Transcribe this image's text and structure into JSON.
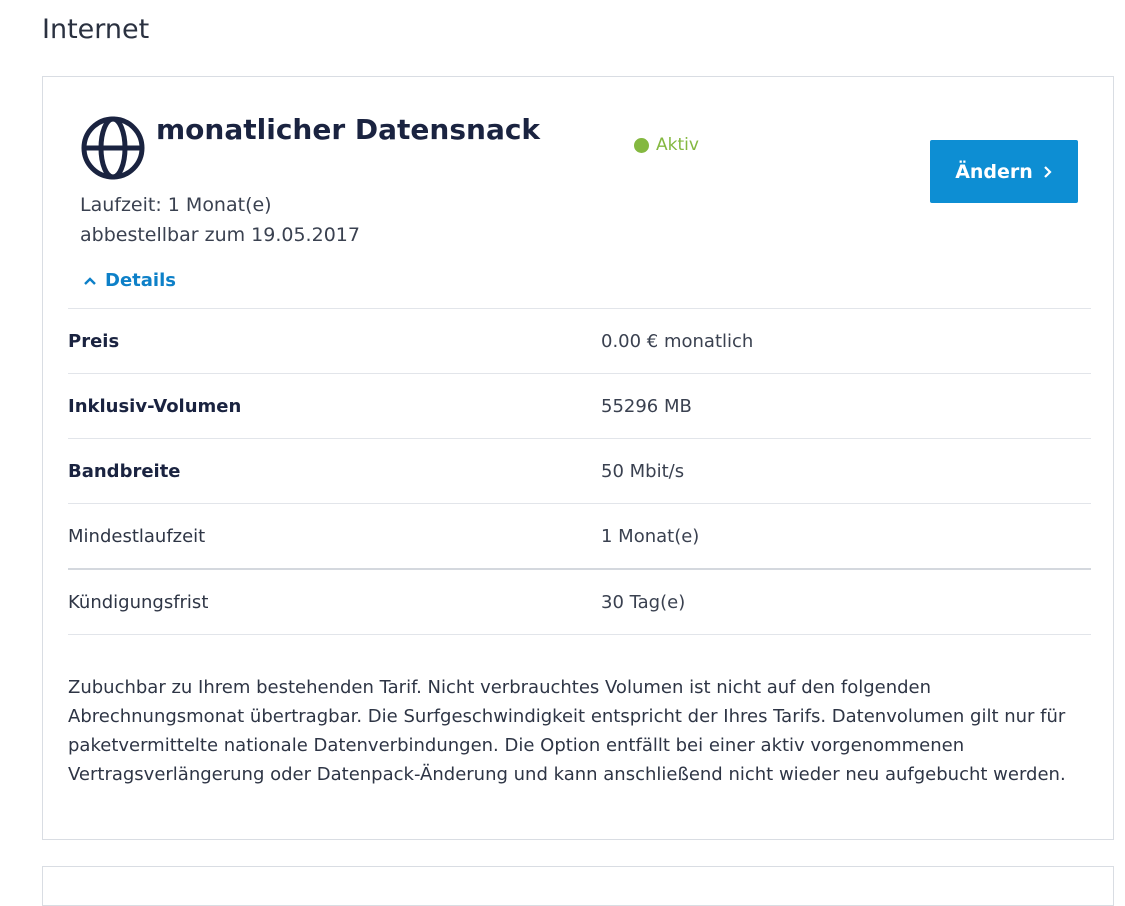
{
  "section": {
    "title": "Internet"
  },
  "product": {
    "name": "monatlicher Datensnack",
    "icon": "globe-icon",
    "laufzeit": "Laufzeit: 1 Monat(e)",
    "abbestellbar": "abbestellbar zum 19.05.2017",
    "status": "Aktiv"
  },
  "actions": {
    "change_label": "Ändern",
    "details_label": "Details"
  },
  "details": {
    "rows": [
      {
        "label": "Preis",
        "value": "0.00 € monatlich"
      },
      {
        "label": "Inklusiv-Volumen",
        "value": "55296 MB"
      },
      {
        "label": "Bandbreite",
        "value": "50 Mbit/s"
      },
      {
        "label": "Mindestlaufzeit",
        "value": "1 Monat(e)"
      },
      {
        "label": "Kündigungsfrist",
        "value": "30 Tag(e)"
      }
    ]
  },
  "description": "Zubuchbar zu Ihrem bestehenden Tarif. Nicht verbrauchtes Volumen ist nicht auf den folgenden Abrechnungsmonat übertragbar. Die Surfgeschwindigkeit entspricht der Ihres Tarifs. Datenvolumen gilt nur für paketvermittelte nationale Datenverbindungen. Die Option entfällt bei einer aktiv vorgenommenen Vertragsverlängerung oder Datenpack-Änderung und kann anschließend nicht wieder neu aufgebucht werden.",
  "colors": {
    "accent": "#0d8ed3",
    "status": "#84b840",
    "link": "#0d80c8",
    "text": "#1a2340"
  }
}
